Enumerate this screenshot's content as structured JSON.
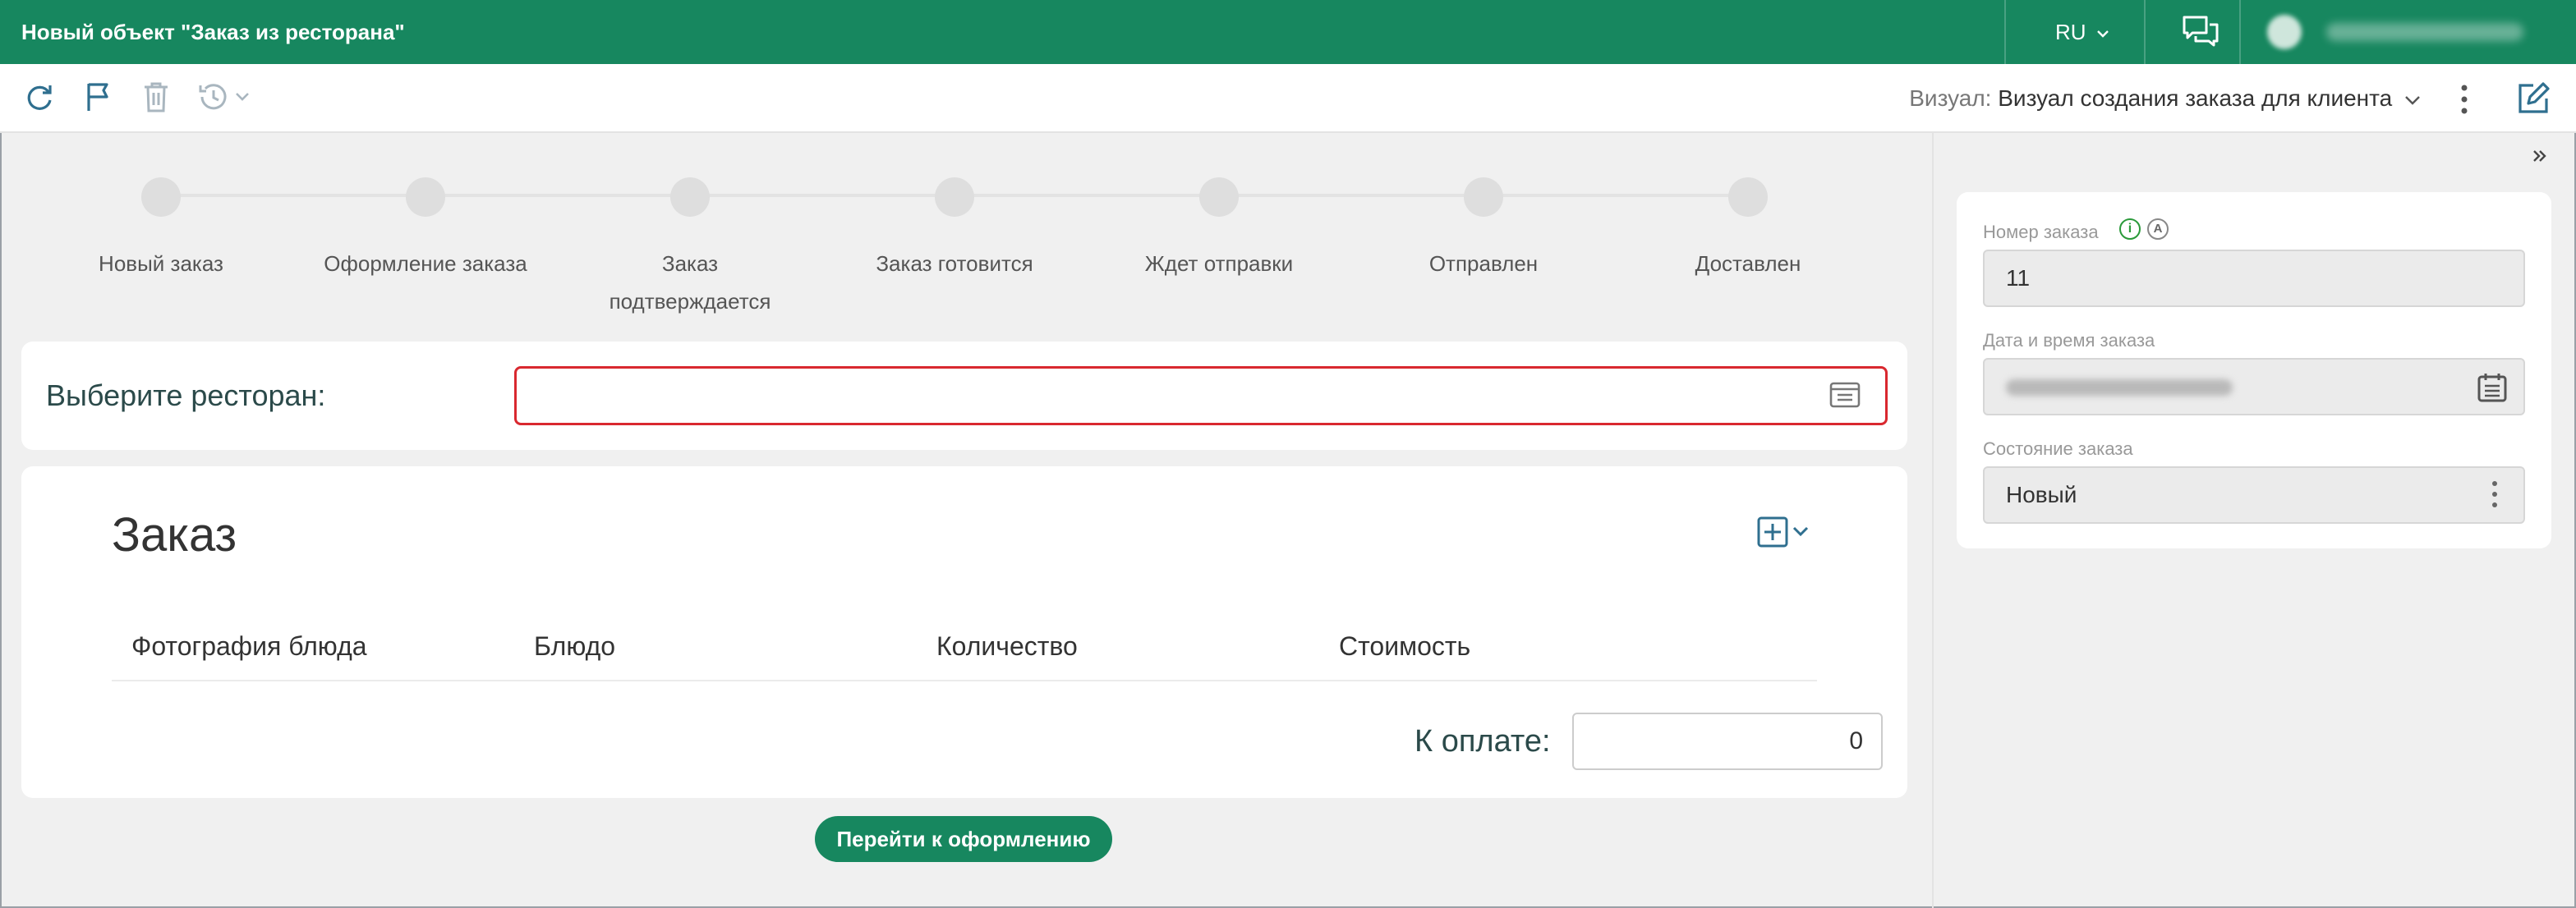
{
  "header": {
    "title": "Новый объект \"Заказ из ресторана\"",
    "language": "RU"
  },
  "toolbar": {
    "visual_label": "Визуал:",
    "visual_value": "Визуал создания заказа для клиента"
  },
  "steps": [
    "Новый заказ",
    "Оформление заказа",
    "Заказ подтверждается",
    "Заказ готовится",
    "Ждет отправки",
    "Отправлен",
    "Доставлен"
  ],
  "restaurant": {
    "label": "Выберите ресторан:",
    "value": ""
  },
  "order": {
    "title": "Заказ",
    "columns": [
      "Фотография блюда",
      "Блюдо",
      "Количество",
      "Стоимость"
    ],
    "rows": [],
    "payment_label": "К оплате:",
    "payment_value": "0"
  },
  "action_button": "Перейти к оформлению",
  "side_panel": {
    "order_number_label": "Номер заказа",
    "order_number_value": "11",
    "datetime_label": "Дата и время заказа",
    "status_label": "Состояние заказа",
    "status_value": "Новый"
  },
  "colors": {
    "brand": "#17875f",
    "error_border": "#d9282f"
  }
}
